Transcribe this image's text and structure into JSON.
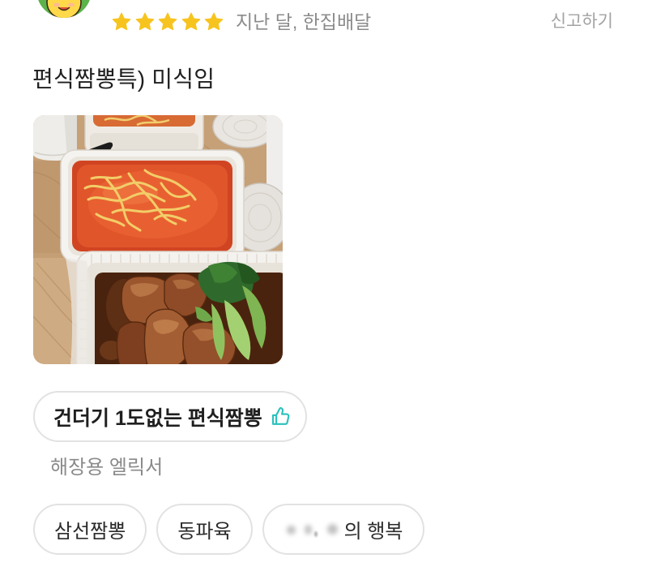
{
  "theme": {
    "star": "#f7c41f",
    "accent": "#2ac1bc",
    "text_primary": "#1f1f1f",
    "text_secondary": "#8a8a8a",
    "border": "#e2e2e2"
  },
  "reviewer": {
    "avatar_icon": "avatar-icon"
  },
  "rating": {
    "stars": 5,
    "max_stars": 5
  },
  "meta": {
    "date_delivery": "지난 달, 한집배달",
    "report_label": "신고하기"
  },
  "review": {
    "text": "편식짬뽕특) 미식임"
  },
  "liked_menu": {
    "name": "건더기 1도없는 편식짬뽕",
    "icon": "thumbs-up-icon",
    "comment": "해장용 엘릭서"
  },
  "menu_tags": [
    {
      "label": "삼선짬뽕"
    },
    {
      "label": "동파육"
    },
    {
      "label": "의 행복",
      "redacted_prefix": true
    }
  ]
}
